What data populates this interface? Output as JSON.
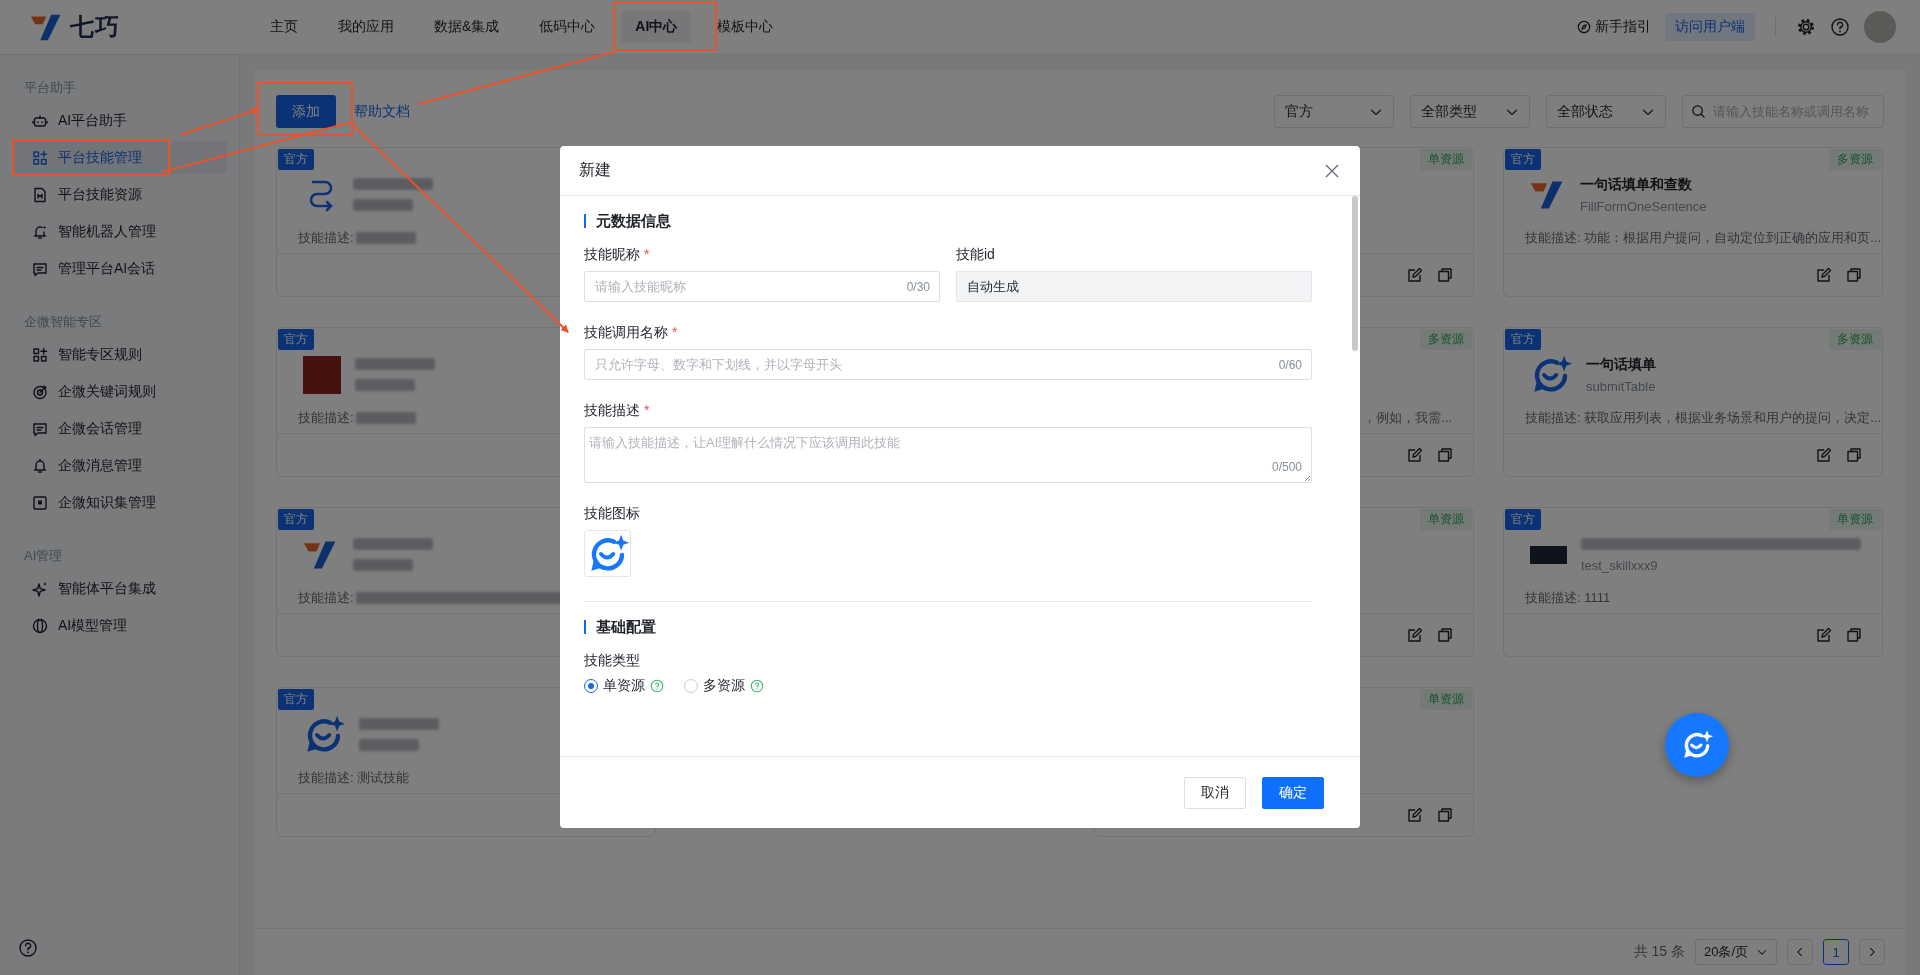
{
  "topbar": {
    "logo": "七巧",
    "nav": [
      {
        "label": "主页",
        "selected": false
      },
      {
        "label": "我的应用",
        "selected": false
      },
      {
        "label": "数据&集成",
        "selected": false
      },
      {
        "label": "低码中心",
        "selected": false
      },
      {
        "label": "AI中心",
        "selected": true
      },
      {
        "label": "模板中心",
        "selected": false
      }
    ],
    "guide": "新手指引",
    "visit_button": "访问用户端"
  },
  "sidebar": {
    "groups": [
      {
        "title": "平台助手",
        "items": [
          {
            "label": "AI平台助手",
            "selected": false
          },
          {
            "label": "平台技能管理",
            "selected": true
          },
          {
            "label": "平台技能资源",
            "selected": false
          },
          {
            "label": "智能机器人管理",
            "selected": false
          },
          {
            "label": "管理平台AI会话",
            "selected": false
          }
        ]
      },
      {
        "title": "企微智能专区",
        "items": [
          {
            "label": "智能专区规则",
            "selected": false
          },
          {
            "label": "企微关键词规则",
            "selected": false
          },
          {
            "label": "企微会话管理",
            "selected": false
          },
          {
            "label": "企微消息管理",
            "selected": false
          },
          {
            "label": "企微知识集管理",
            "selected": false
          }
        ]
      },
      {
        "title": "AI管理",
        "items": [
          {
            "label": "智能体平台集成",
            "selected": false
          },
          {
            "label": "AI模型管理",
            "selected": false
          }
        ]
      }
    ]
  },
  "toolbar": {
    "add_button": "添加",
    "help_link": "帮助文档",
    "filters": [
      {
        "value": "官方"
      },
      {
        "value": "全部类型"
      },
      {
        "value": "全部状态"
      }
    ],
    "search": {
      "placeholder": "请输入技能名称或调用名称"
    }
  },
  "card_columns": [
    [
      {
        "badge": "官方",
        "kind": "arrows",
        "name_blurred": true,
        "call_name_blurred": true,
        "desc": "技能描述:",
        "desc_blurred": true
      },
      {
        "badge": "官方",
        "kind": "photo",
        "name_blurred": true,
        "call_name_blurred": true,
        "desc": "技能描述:",
        "desc_blurred": true
      },
      {
        "badge": "官方",
        "kind": "logo",
        "name_blurred": true,
        "call_name_blurred": true,
        "desc": "技能描述:",
        "desc_blurred": true
      },
      {
        "badge": "官方",
        "kind": "assistant",
        "name_blurred": true,
        "call_name_blurred": true,
        "desc": "技能描述: 测试技能"
      }
    ],
    [
      {
        "kind": "covered",
        "type_tag": "单资源"
      },
      {
        "kind": "covered",
        "type_tag": "多资源",
        "desc": "，例如，我需...",
        "desc_cut": true
      },
      {
        "kind": "covered",
        "type_tag": "单资源"
      },
      {
        "kind": "covered",
        "type_tag": "单资源"
      }
    ],
    [
      {
        "badge": "官方",
        "type_tag": "多资源",
        "kind": "logo",
        "name": "一句话填单和查数",
        "call_name": "FillFormOneSentence",
        "desc": "技能描述: 功能：根据用户提问，自动定位到正确的应用和页..."
      },
      {
        "badge": "官方",
        "type_tag": "多资源",
        "kind": "assistant",
        "name": "一句话填单",
        "call_name": "submitTable",
        "desc": "技能描述: 获取应用列表，根据业务场景和用户的提问，决定..."
      },
      {
        "badge": "官方",
        "type_tag": "单资源",
        "kind": "dark-photo",
        "name_blurred": true,
        "call_name": "test_skillxxx9",
        "desc": "技能描述: 1111"
      }
    ]
  ],
  "pagination": {
    "total": "共 15 条",
    "page_size": "20条/页",
    "pages": [
      {
        "label": "1",
        "selected": true
      }
    ]
  },
  "modal": {
    "title": "新建",
    "sections": [
      {
        "title": "元数据信息",
        "rows": [
          [
            {
              "kind": "input",
              "label": "技能昵称",
              "required_mark": "*",
              "disabled": false,
              "placeholder": "请输入技能昵称",
              "counter": "0/30"
            },
            {
              "kind": "input",
              "label": "技能id",
              "disabled": true,
              "value": "自动生成"
            }
          ],
          [
            {
              "kind": "input",
              "label": "技能调用名称",
              "required_mark": "*",
              "disabled": false,
              "placeholder": "只允许字母、数字和下划线，并以字母开头",
              "counter": "0/60"
            }
          ],
          [
            {
              "kind": "textarea",
              "label": "技能描述",
              "required_mark": "*",
              "disabled": false,
              "placeholder": "请输入技能描述，让AI理解什么情况下应该调用此技能",
              "counter": "0/500"
            }
          ],
          [
            {
              "kind": "icon",
              "label": "技能图标"
            }
          ]
        ]
      },
      {
        "title": "基础配置",
        "rows": [
          [
            {
              "kind": "radio",
              "label": "技能类型",
              "options": [
                {
                  "label": "单资源",
                  "selected": true
                },
                {
                  "label": "多资源",
                  "selected": false
                }
              ]
            }
          ]
        ]
      }
    ],
    "buttons": [
      {
        "label": "取消",
        "kind": "secondary"
      },
      {
        "label": "确定",
        "kind": "primary"
      }
    ]
  }
}
